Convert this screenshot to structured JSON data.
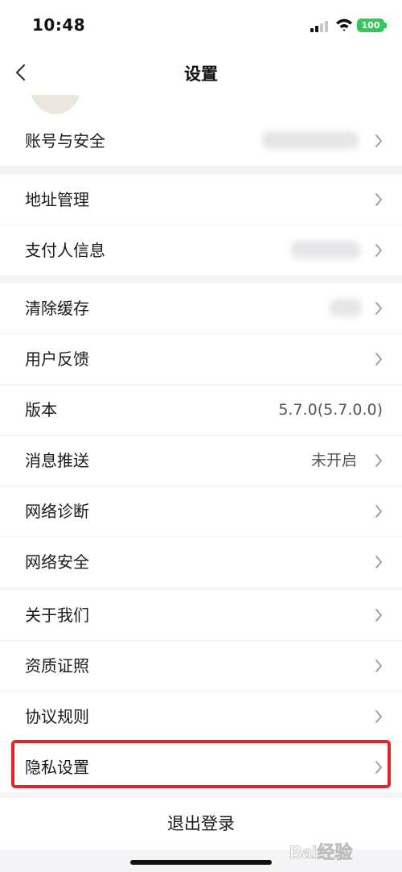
{
  "status_bar": {
    "time": "10:48",
    "battery": "100"
  },
  "header": {
    "title": "设置"
  },
  "groups": [
    {
      "rows": [
        {
          "label": "账号与安全",
          "value": ""
        }
      ]
    },
    {
      "rows": [
        {
          "label": "地址管理",
          "value": ""
        },
        {
          "label": "支付人信息",
          "value": ""
        }
      ]
    },
    {
      "rows": [
        {
          "label": "清除缓存",
          "value": ""
        },
        {
          "label": "用户反馈",
          "value": ""
        },
        {
          "label": "版本",
          "value": "5.7.0(5.7.0.0)"
        },
        {
          "label": "消息推送",
          "value": "未开启"
        },
        {
          "label": "网络诊断",
          "value": ""
        },
        {
          "label": "网络安全",
          "value": ""
        }
      ]
    },
    {
      "rows": [
        {
          "label": "关于我们",
          "value": ""
        },
        {
          "label": "资质证照",
          "value": ""
        },
        {
          "label": "协议规则",
          "value": ""
        },
        {
          "label": "隐私设置",
          "value": ""
        }
      ]
    }
  ],
  "footer": {
    "logout_label": "退出登录"
  },
  "highlight_color": "#e0242c",
  "watermark": {
    "text": "Bai经验"
  }
}
